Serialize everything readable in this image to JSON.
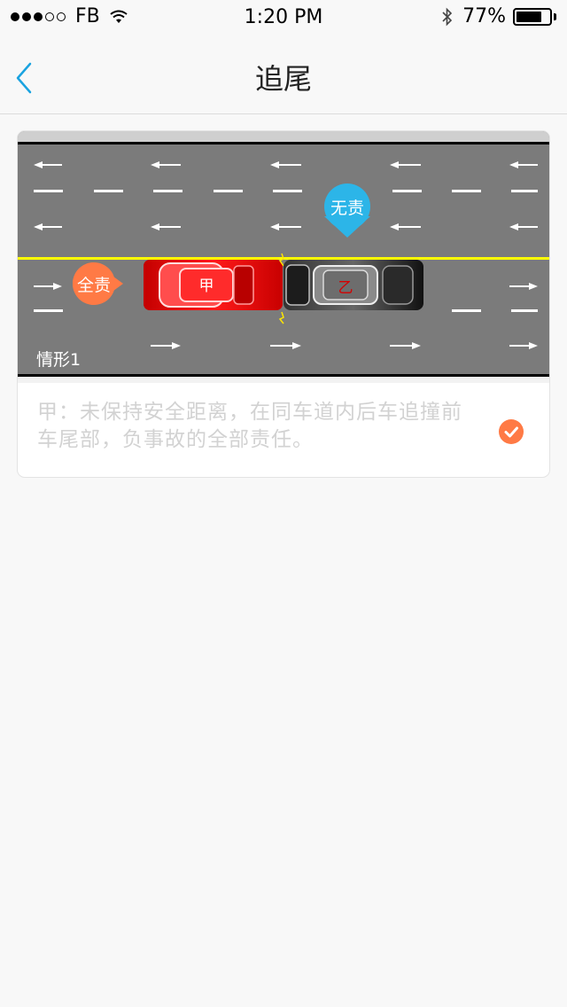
{
  "status_bar": {
    "carrier": "FB",
    "time": "1:20 PM",
    "battery": "77%",
    "battery_level": 0.77
  },
  "nav": {
    "title": "追尾",
    "back_icon": "chevron-left-icon"
  },
  "card": {
    "scene_label": "情形1",
    "car_a_label": "甲",
    "car_b_label": "乙",
    "tag_full": "全责",
    "tag_none": "无责",
    "description": "甲：未保持安全距离，在同车道内后车追撞前车尾部，负事故的全部责任。",
    "selected": true,
    "check_icon": "check-circle-icon"
  },
  "colors": {
    "accent_blue": "#1aa3e0",
    "tag_full": "#ff7a45",
    "tag_none": "#2cb5e8",
    "car_a": "#e60000",
    "road": "#7b7b7b",
    "center_line": "#ffff00"
  }
}
